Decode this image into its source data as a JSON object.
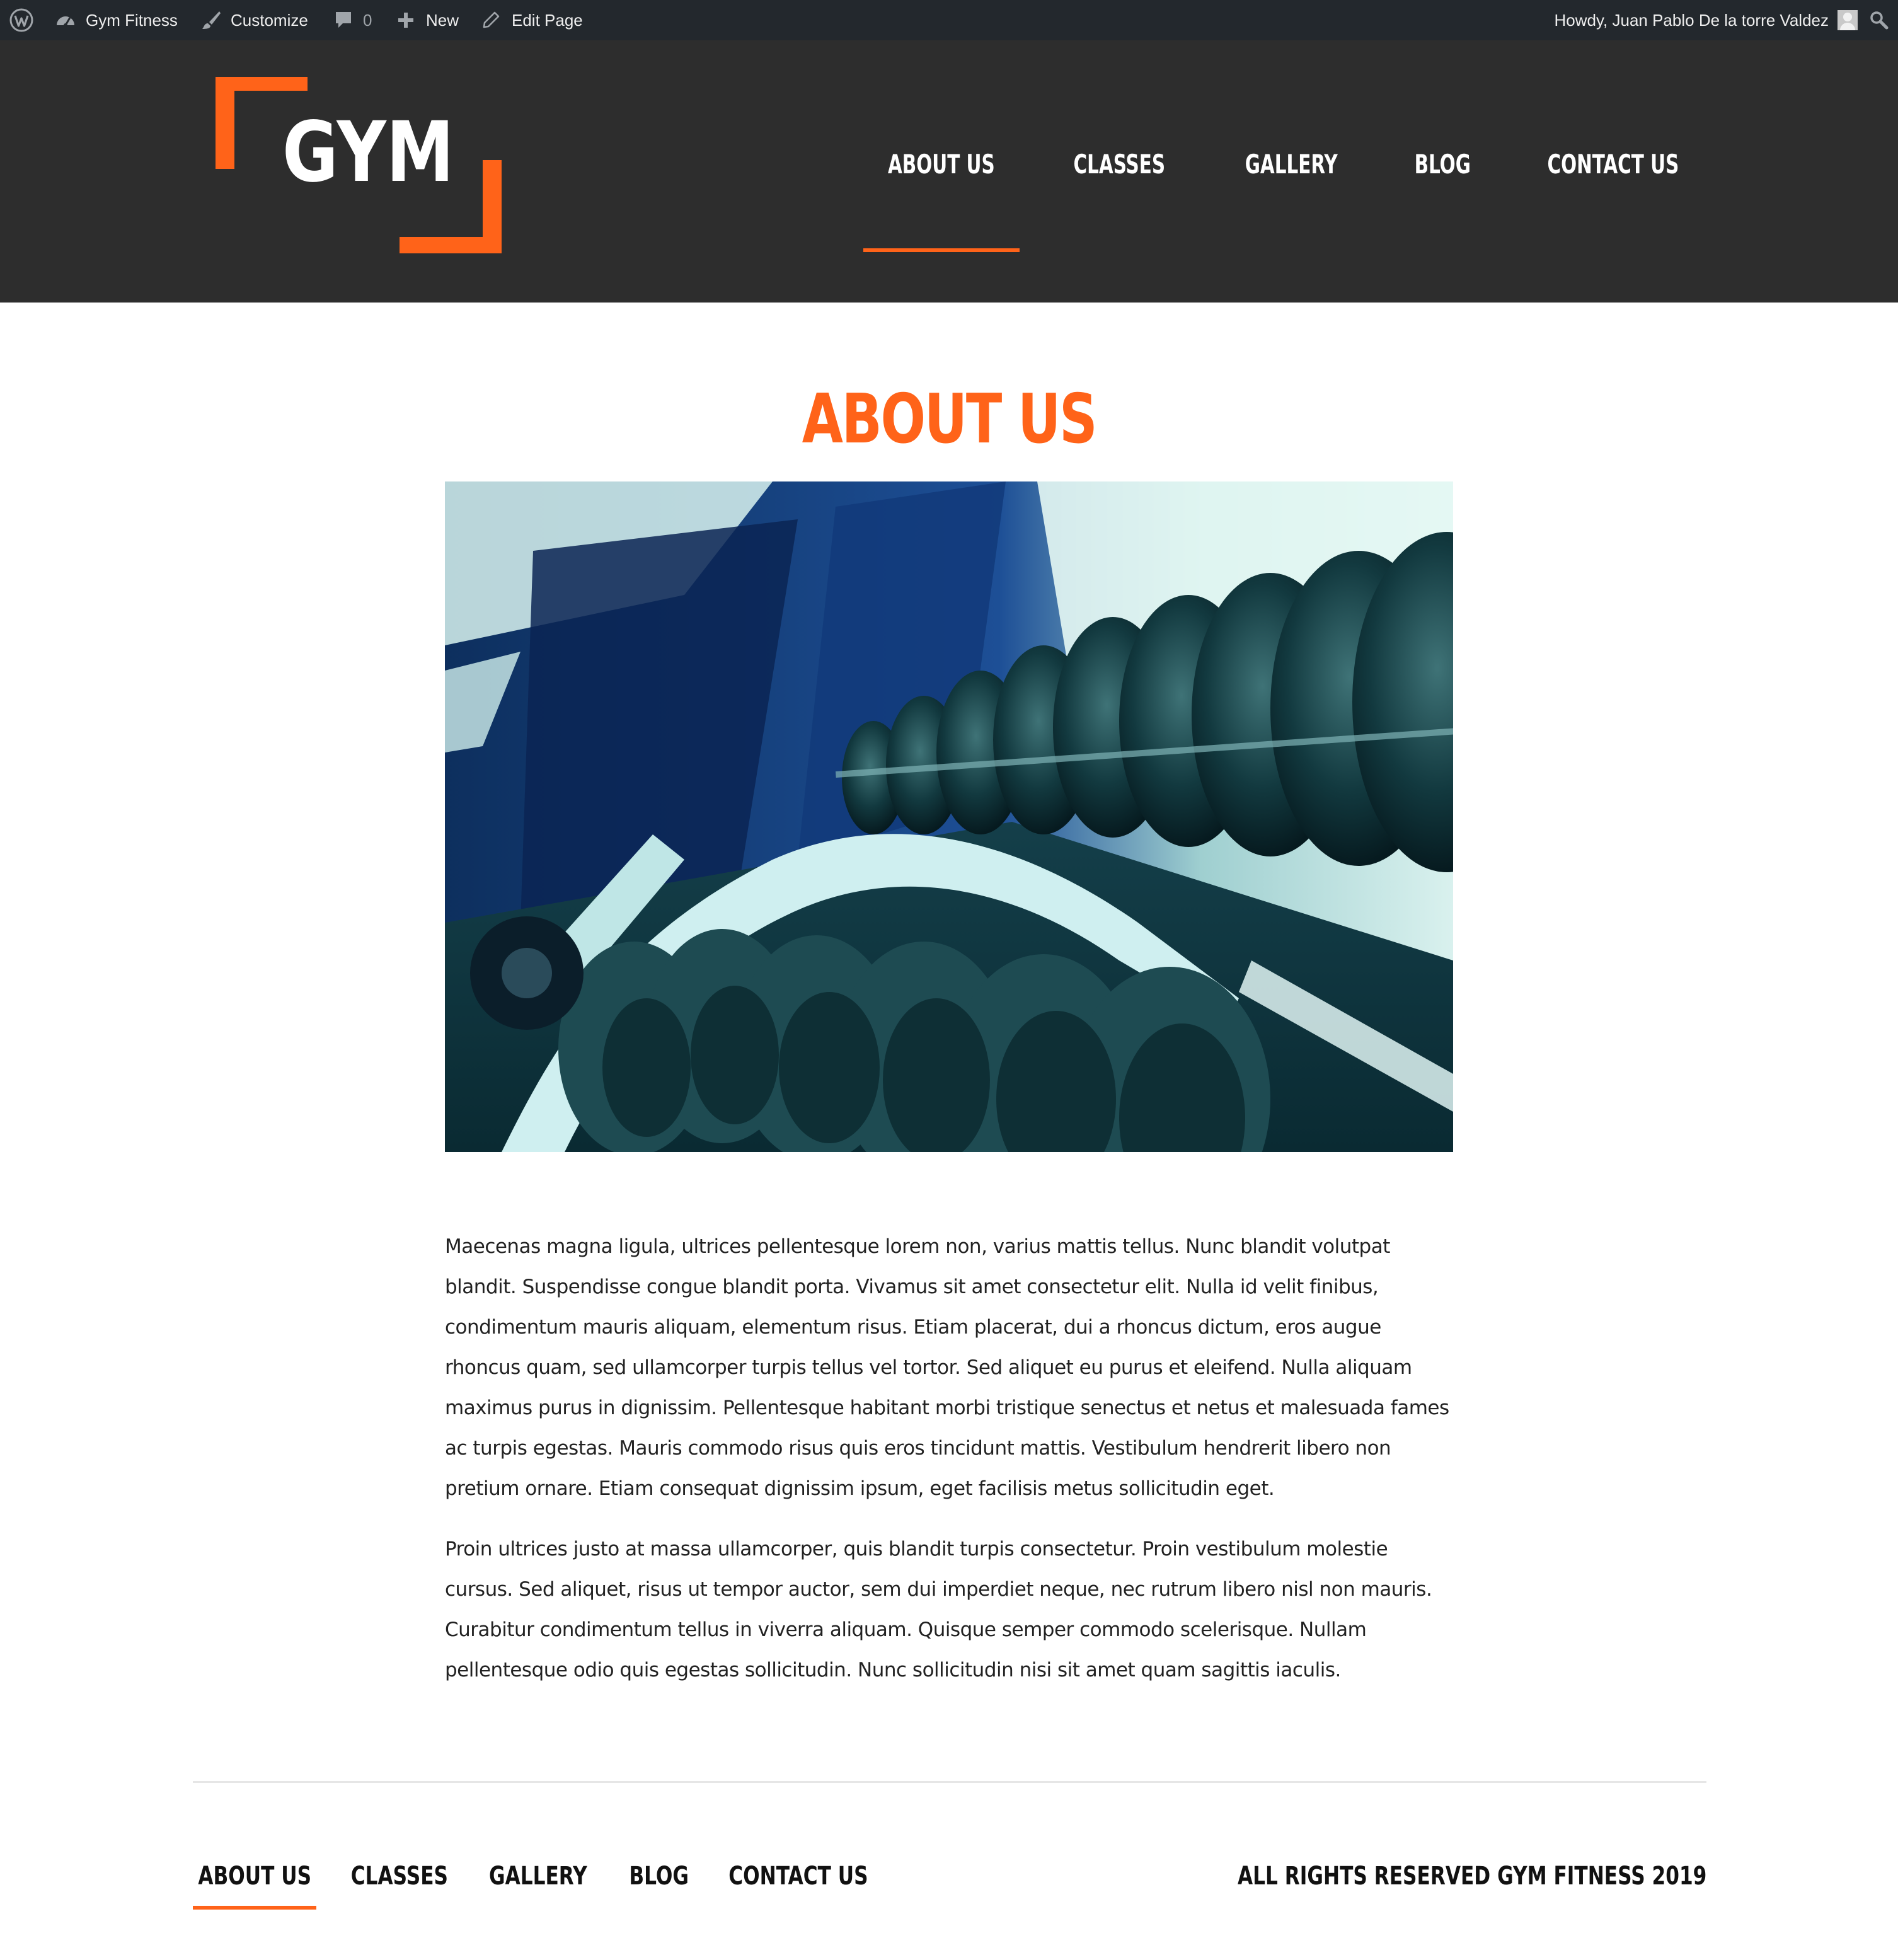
{
  "admin_bar": {
    "site_name": "Gym Fitness",
    "customize_label": "Customize",
    "comments_count": "0",
    "new_label": "New",
    "edit_label": "Edit Page",
    "greeting": "Howdy, Juan Pablo De la torre Valdez"
  },
  "header": {
    "logo_text": "GYM",
    "nav": [
      {
        "label": "About Us",
        "active": true
      },
      {
        "label": "Classes"
      },
      {
        "label": "Gallery"
      },
      {
        "label": "Blog"
      },
      {
        "label": "Contact Us"
      }
    ]
  },
  "main": {
    "title": "About Us",
    "paragraphs": [
      "Maecenas magna ligula, ultrices pellentesque lorem non, varius mattis tellus. Nunc blandit volutpat blandit. Suspendisse congue blandit porta. Vivamus sit amet consectetur elit. Nulla id velit finibus, condimentum mauris aliquam, elementum risus. Etiam placerat, dui a rhoncus dictum, eros augue rhoncus quam, sed ullamcorper turpis tellus vel tortor. Sed aliquet eu purus et eleifend. Nulla aliquam maximus purus in dignissim. Pellentesque habitant morbi tristique senectus et netus et malesuada fames ac turpis egestas. Mauris commodo risus quis eros tincidunt mattis. Vestibulum hendrerit libero non pretium ornare. Etiam consequat dignissim ipsum, eget facilisis metus sollicitudin eget.",
      "Proin ultrices justo at massa ullamcorper, quis blandit turpis consectetur. Proin vestibulum molestie cursus. Sed aliquet, risus ut tempor auctor, sem dui imperdiet neque, nec rutrum libero nisl non mauris. Curabitur condimentum tellus in viverra aliquam. Quisque semper commodo scelerisque. Nullam pellentesque odio quis egestas sollicitudin. Nunc sollicitudin nisi sit amet quam sagittis iaculis."
    ]
  },
  "footer": {
    "nav": [
      {
        "label": "About Us",
        "active": true
      },
      {
        "label": "Classes"
      },
      {
        "label": "Gallery"
      },
      {
        "label": "Blog"
      },
      {
        "label": "Contact Us"
      }
    ],
    "copyright": "All Rights Reserved Gym Fitness 2019"
  },
  "colors": {
    "accent": "#ff6319",
    "header_bg": "#2d2d2d",
    "admin_bg": "#23282d"
  },
  "icons": [
    "wordpress-icon",
    "dashboard-icon",
    "brush-icon",
    "comment-icon",
    "plus-icon",
    "pencil-icon",
    "avatar",
    "search-icon"
  ]
}
